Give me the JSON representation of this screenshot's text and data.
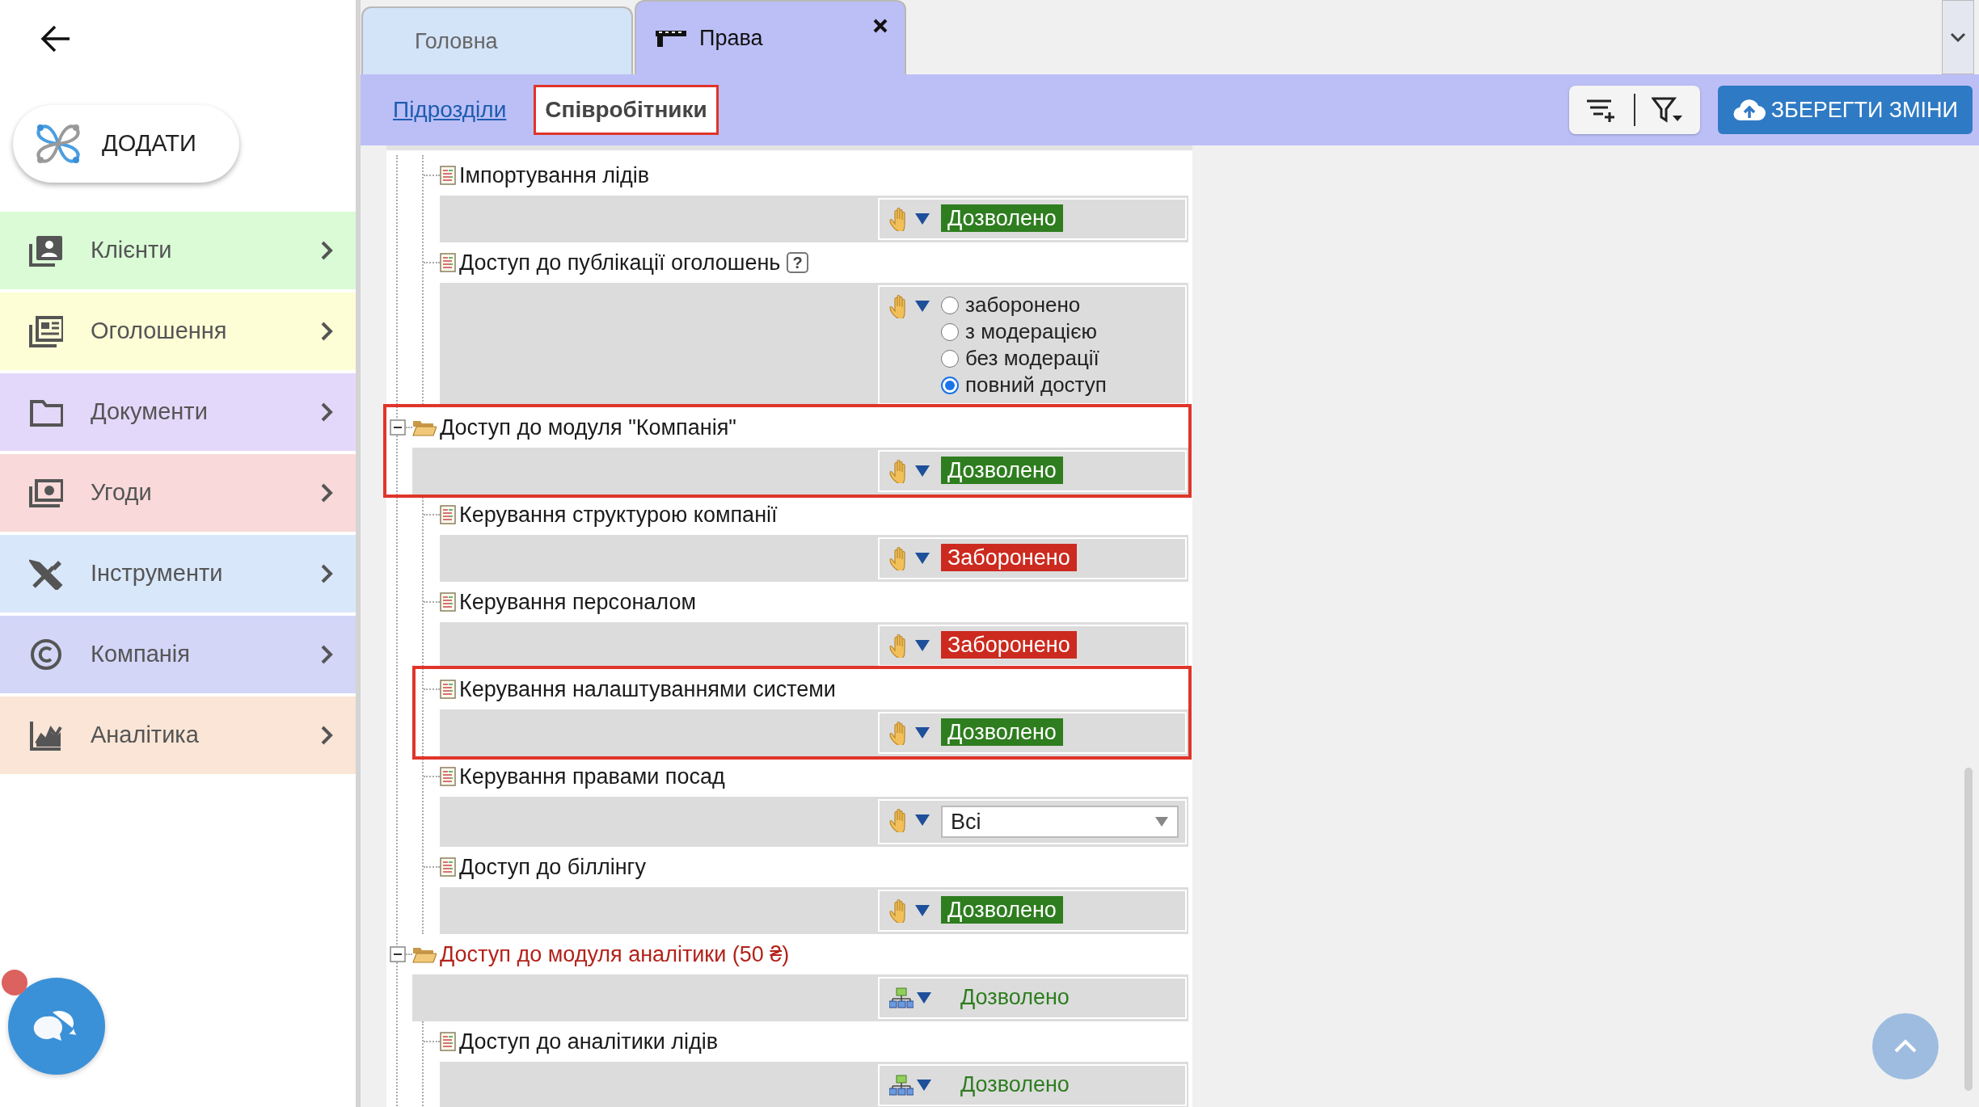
{
  "sidebar": {
    "add_button": {
      "label": "ДОДАТИ"
    },
    "menu": [
      {
        "label": "Клієнти",
        "color": "#dafbd6"
      },
      {
        "label": "Оголошення",
        "color": "#fdfdd6"
      },
      {
        "label": "Документи",
        "color": "#e4d8fa"
      },
      {
        "label": "Угоди",
        "color": "#f9d9d9"
      },
      {
        "label": "Інструменти",
        "color": "#d9e7fa"
      },
      {
        "label": "Компанія",
        "color": "#d3d6f7"
      },
      {
        "label": "Аналітика",
        "color": "#fae5d6"
      }
    ],
    "chat": {
      "unread": true
    }
  },
  "tabs": [
    {
      "label": "Головна",
      "selected": false,
      "closable": false,
      "has_icon": false
    },
    {
      "label": "Права",
      "selected": true,
      "closable": true,
      "has_icon": true
    }
  ],
  "subtabs": [
    {
      "label": "Підрозділи",
      "selected": false
    },
    {
      "label": "Співробітники",
      "selected": true
    }
  ],
  "save_button": {
    "label": "ЗБЕРЕГТИ ЗМІНИ"
  },
  "tree": {
    "continued_children": [
      {
        "kind": "leaf",
        "label": "Імпортування лідів",
        "highlighted": false,
        "inherited": false,
        "control": {
          "kind": "badge",
          "value": "Дозволено",
          "allowed": true
        }
      },
      {
        "kind": "leaf",
        "label": "Доступ до публікації оголошень",
        "help": "?",
        "highlighted": false,
        "inherited": false,
        "control": {
          "kind": "radio",
          "options": [
            {
              "label": "заборонено",
              "selected": false
            },
            {
              "label": "з модерацією",
              "selected": false
            },
            {
              "label": "без модерації",
              "selected": false
            },
            {
              "label": "повний доступ",
              "selected": true
            }
          ]
        }
      }
    ],
    "nodes": [
      {
        "kind": "group",
        "label": "Доступ до модуля \"Компанія\"",
        "paid": false,
        "expanded": true,
        "highlighted": true,
        "inherited": false,
        "control": {
          "kind": "badge",
          "value": "Дозволено",
          "allowed": true
        },
        "children": [
          {
            "kind": "leaf",
            "label": "Керування структурою компанії",
            "highlighted": false,
            "inherited": false,
            "control": {
              "kind": "badge",
              "value": "Заборонено",
              "allowed": false
            }
          },
          {
            "kind": "leaf",
            "label": "Керування персоналом",
            "highlighted": false,
            "inherited": false,
            "control": {
              "kind": "badge",
              "value": "Заборонено",
              "allowed": false
            }
          },
          {
            "kind": "leaf",
            "label": "Керування налаштуваннями системи",
            "highlighted": true,
            "inherited": false,
            "control": {
              "kind": "badge",
              "value": "Дозволено",
              "allowed": true
            }
          },
          {
            "kind": "leaf",
            "label": "Керування правами посад",
            "highlighted": false,
            "inherited": false,
            "control": {
              "kind": "select",
              "value": "Всі"
            }
          },
          {
            "kind": "leaf",
            "label": "Доступ до біллінгу",
            "highlighted": false,
            "inherited": false,
            "control": {
              "kind": "badge",
              "value": "Дозволено",
              "allowed": true
            }
          }
        ]
      },
      {
        "kind": "group",
        "label": "Доступ до модуля аналітики (50 ₴)",
        "paid": true,
        "expanded": true,
        "highlighted": false,
        "inherited": true,
        "control": {
          "kind": "text",
          "value": "Дозволено",
          "allowed": true
        },
        "children": [
          {
            "kind": "leaf",
            "label": "Доступ до аналітики лідів",
            "highlighted": false,
            "inherited": true,
            "control": {
              "kind": "text",
              "value": "Дозволено",
              "allowed": true
            }
          }
        ]
      }
    ]
  }
}
